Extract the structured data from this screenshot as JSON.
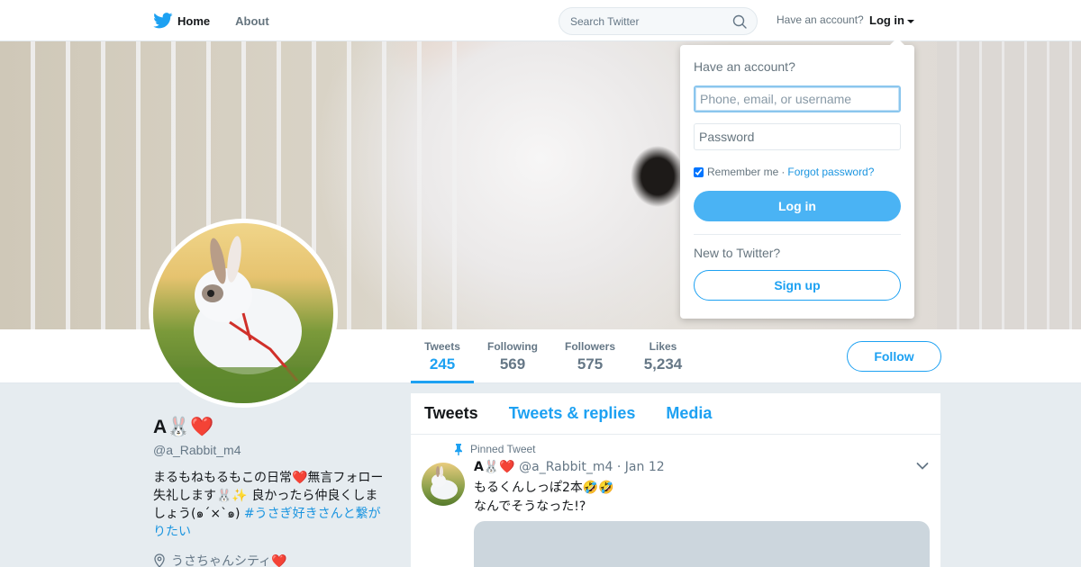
{
  "nav": {
    "home_label": "Home",
    "about_label": "About",
    "search_placeholder": "Search Twitter",
    "have_account": "Have an account?",
    "login_label": "Log in",
    "icons": [
      "twitter-bird-icon",
      "search-icon",
      "caret-down-icon"
    ]
  },
  "stats": {
    "tweets_label": "Tweets",
    "tweets_value": "245",
    "following_label": "Following",
    "following_value": "569",
    "followers_label": "Followers",
    "followers_value": "575",
    "likes_label": "Likes",
    "likes_value": "5,234",
    "follow_button": "Follow"
  },
  "profile": {
    "name": "A🐰❤️",
    "handle": "@a_Rabbit_m4",
    "bio": "まるもねもるもこの日常❤️無言フォロー失礼します🐰✨ 良かったら仲良くしましょう(๑´×`๑) ",
    "bio_hashtag": "#うさぎ好きさんと繋がりたい",
    "location": "うさちゃんシティ❤️"
  },
  "timeline": {
    "tabs": [
      {
        "label": "Tweets",
        "active": true
      },
      {
        "label": "Tweets & replies",
        "active": false
      },
      {
        "label": "Media",
        "active": false
      }
    ],
    "pinned_label": "Pinned Tweet",
    "tweet": {
      "name": "A🐰❤️",
      "handle": "@a_Rabbit_m4",
      "separator": "·",
      "date": "Jan 12",
      "line1": "もるくんしっぽ2本🤣🤣",
      "line2": "なんでそうなった!?"
    }
  },
  "login_dropdown": {
    "title": "Have an account?",
    "username_placeholder": "Phone, email, or username",
    "password_placeholder": "Password",
    "remember_label": "Remember me",
    "separator": "·",
    "forgot_label": "Forgot password?",
    "remember_checked": true,
    "login_button": "Log in",
    "new_prompt": "New to Twitter?",
    "signup_button": "Sign up"
  },
  "colors": {
    "accent": "#1da1f2",
    "login_button": "#4ab3f4",
    "background": "#e6ecf0"
  }
}
